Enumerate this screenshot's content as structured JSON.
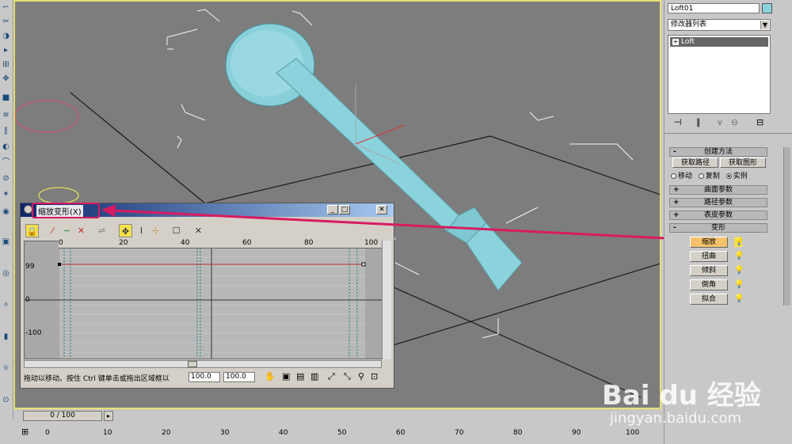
{
  "object_name": "Loft01",
  "modifier_list": {
    "label": "修改器列表"
  },
  "modifier_stack": {
    "items": [
      "Loft"
    ]
  },
  "creation_method": {
    "title": "创建方法",
    "get_path": "获取路径",
    "get_shape": "获取图形",
    "move": "移动",
    "copy": "复制",
    "instance": "实例"
  },
  "rollouts": {
    "surface_params": "曲面参数",
    "path_params": "路径参数",
    "skin_params": "表皮参数",
    "deformations": "变形"
  },
  "deformations": {
    "scale": "缩放",
    "twist": "扭曲",
    "teeter": "倾斜",
    "bevel": "倒角",
    "fit": "拟合"
  },
  "scale_window": {
    "title": "缩放变形(X)",
    "ruler_ticks": [
      "0",
      "20",
      "40",
      "60",
      "80",
      "100"
    ],
    "y_labels": [
      "99",
      "0",
      "-100"
    ],
    "status_text": "拖动以移动。按住 Ctrl 键单击或拖出区域框以",
    "value1": "100.0",
    "value2": "100.0"
  },
  "time_slider": {
    "label": "0 / 100"
  },
  "timeline_ticks": [
    "0",
    "10",
    "20",
    "30",
    "40",
    "50",
    "60",
    "70",
    "80",
    "90",
    "100"
  ],
  "watermark": {
    "brand": "Bai du 经验",
    "url": "jingyan.baidu.com"
  },
  "colors": {
    "highlight": "#d81b60",
    "viewport_border": "#e8e070",
    "object": "#8ad2dc"
  }
}
